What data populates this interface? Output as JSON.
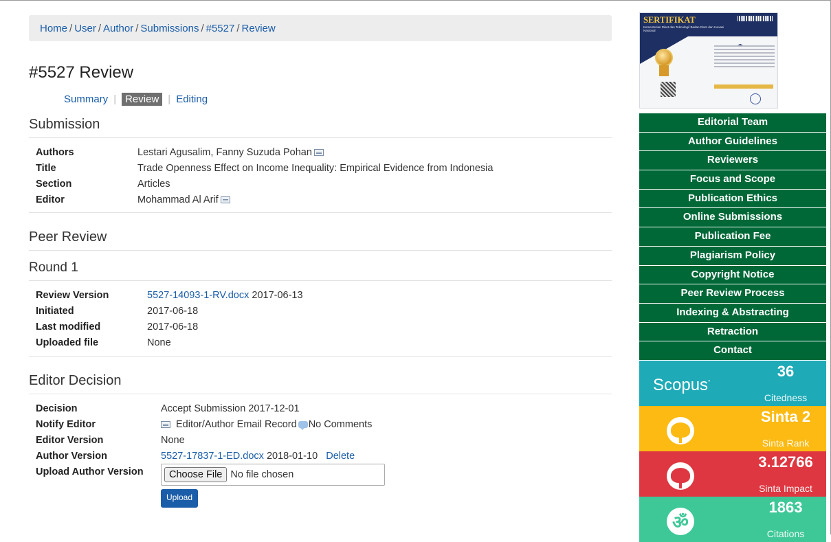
{
  "breadcrumb": [
    {
      "label": "Home"
    },
    {
      "label": "User"
    },
    {
      "label": "Author"
    },
    {
      "label": "Submissions"
    },
    {
      "label": "#5527"
    },
    {
      "label": "Review"
    }
  ],
  "page_title": "#5527 Review",
  "subnav": {
    "summary": "Summary",
    "review": "Review",
    "editing": "Editing"
  },
  "submission": {
    "heading": "Submission",
    "authors_label": "Authors",
    "authors": "Lestari Agusalim, Fanny Suzuda Pohan",
    "title_label": "Title",
    "title": "Trade Openness Effect on Income Inequality: Empirical Evidence from Indonesia",
    "section_label": "Section",
    "section": "Articles",
    "editor_label": "Editor",
    "editor": "Mohammad Al Arif"
  },
  "peer_review": {
    "heading": "Peer Review"
  },
  "round": {
    "heading": "Round 1",
    "review_version_label": "Review Version",
    "review_version_file": "5527-14093-1-RV.docx",
    "review_version_date": "2017-06-13",
    "initiated_label": "Initiated",
    "initiated": "2017-06-18",
    "last_modified_label": "Last modified",
    "last_modified": "2017-06-18",
    "uploaded_file_label": "Uploaded file",
    "uploaded_file": "None"
  },
  "editor_decision": {
    "heading": "Editor Decision",
    "decision_label": "Decision",
    "decision": "Accept Submission 2017-12-01",
    "notify_label": "Notify Editor",
    "notify_text": "Editor/Author Email Record",
    "no_comments": "No Comments",
    "editor_version_label": "Editor Version",
    "editor_version": "None",
    "author_version_label": "Author Version",
    "author_version_file": "5527-17837-1-ED.docx",
    "author_version_date": "2018-01-10",
    "delete_label": "Delete",
    "upload_author_label": "Upload Author Version",
    "choose_file": "Choose File",
    "no_file": "No file chosen",
    "upload_button": "Upload"
  },
  "sidebar": {
    "certificate": {
      "title": "SERTIFIKAT",
      "subtitle": "Kementerian Riset dan Teknologi/ Badan Riset dan Inovasi Nasional"
    },
    "menu": [
      "Editorial Team",
      "Author Guidelines",
      "Reviewers",
      "Focus and Scope",
      "Publication Ethics",
      "Online Submissions",
      "Publication Fee",
      "Plagiarism Policy",
      "Copyright Notice",
      "Peer Review Process",
      "Indexing & Abstracting",
      "Retraction",
      "Contact"
    ],
    "scopus": {
      "brand": "Scopus",
      "value": "36",
      "label": "Citedness"
    },
    "sinta": {
      "value": "Sinta 2",
      "label": "Sinta Rank"
    },
    "impact": {
      "value": "3.12766",
      "label": "Sinta Impact"
    },
    "citations": {
      "value": "1863",
      "label": "Citations"
    }
  },
  "colors": {
    "link": "#1a5da8",
    "menu_green": "#006837",
    "scopus": "#1eaab7",
    "sinta": "#fcba13",
    "impact": "#de3741",
    "citations": "#3ec898"
  }
}
